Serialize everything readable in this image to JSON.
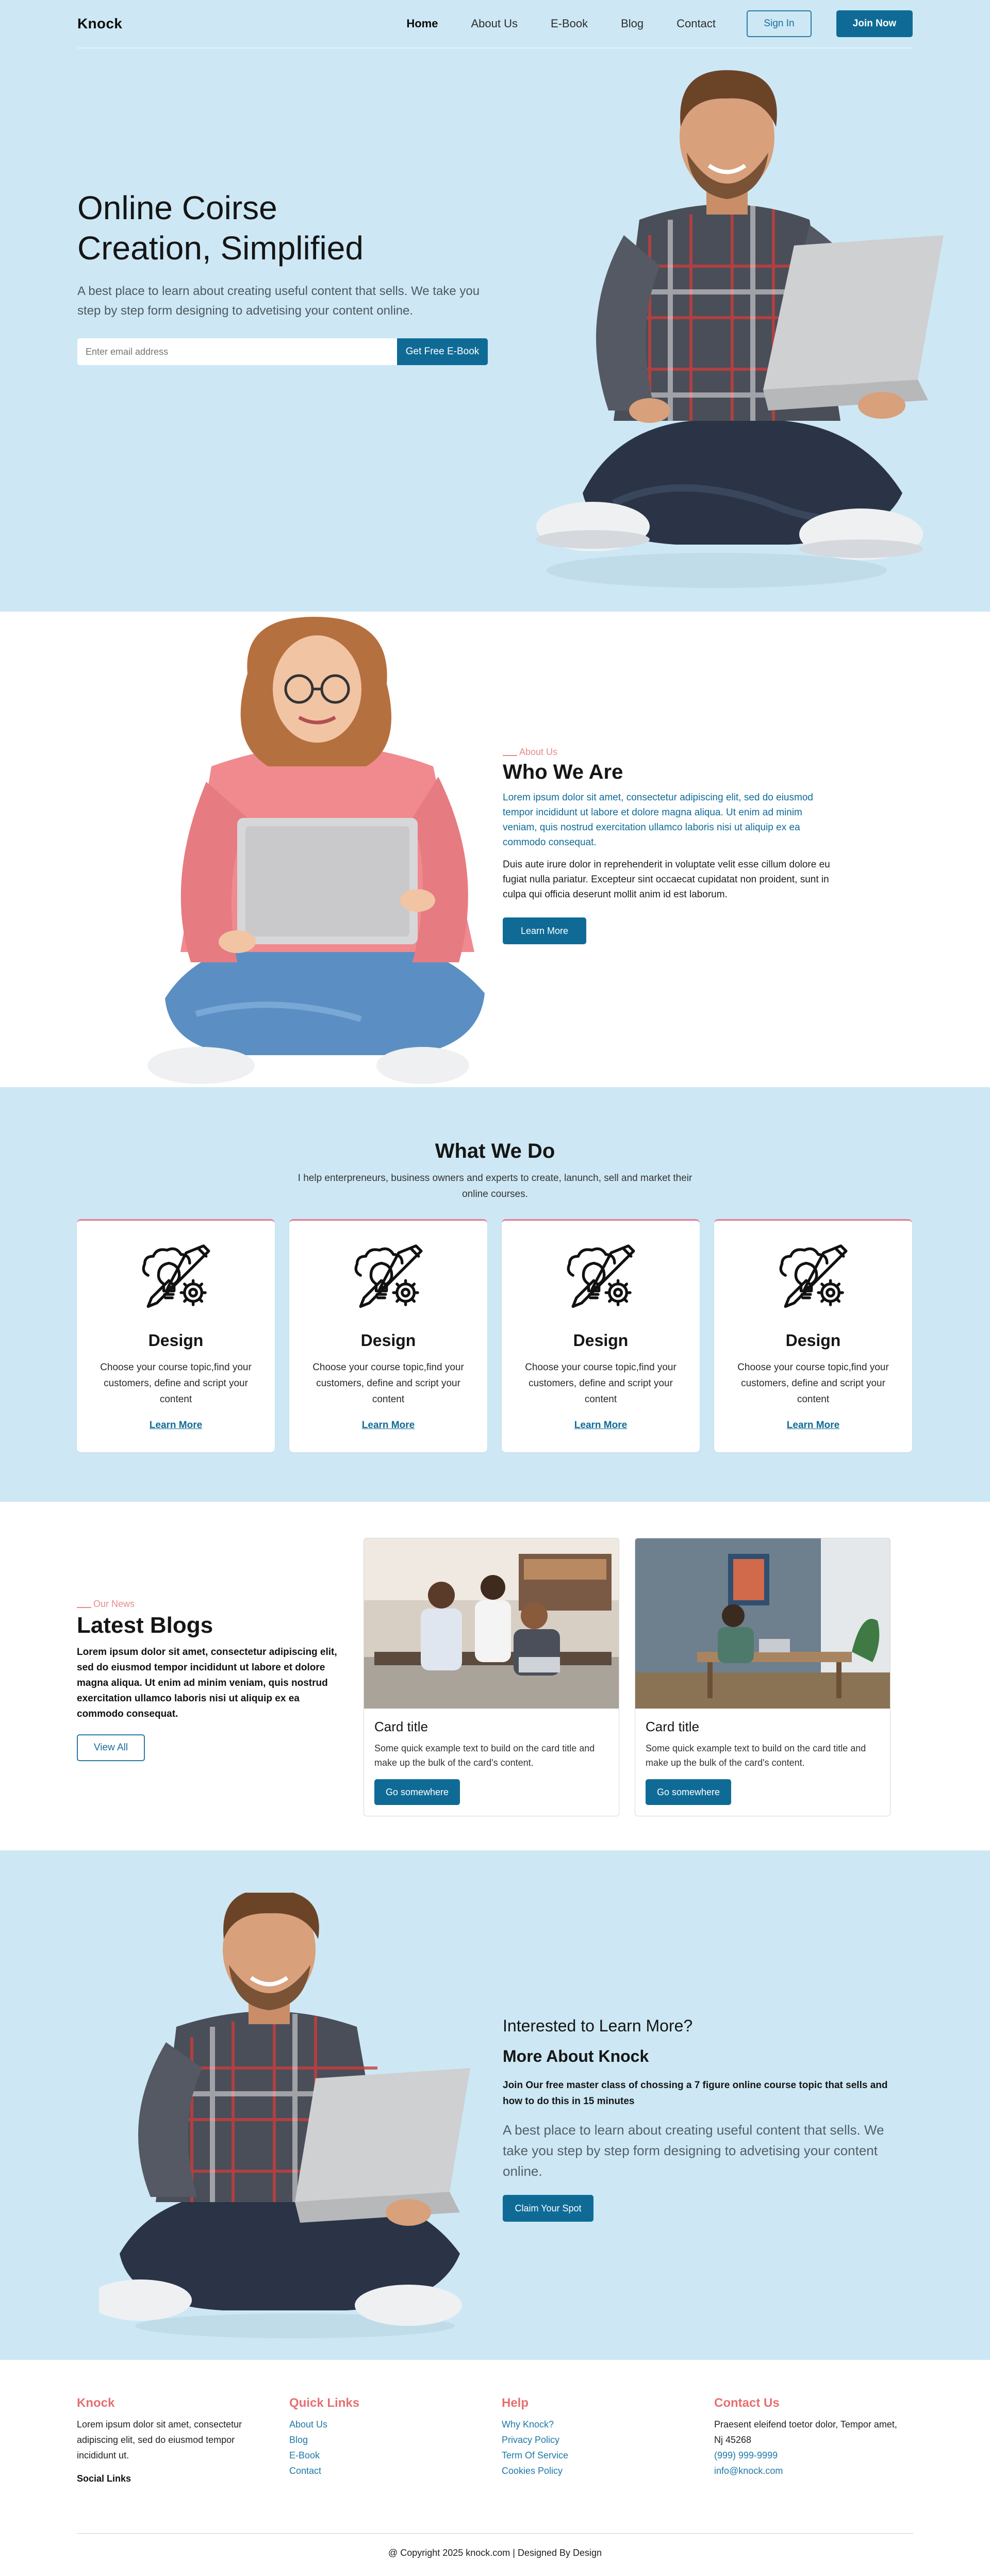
{
  "nav": {
    "brand": "Knock",
    "links": [
      "Home",
      "About Us",
      "E-Book",
      "Blog",
      "Contact"
    ],
    "sign_in": "Sign In",
    "join": "Join Now"
  },
  "hero": {
    "title_line1": "Online Coirse",
    "title_line2": "Creation, Simplified",
    "subtitle": "A best place to learn about creating useful content that sells. We take you step by step form designing to advetising your content online.",
    "email_placeholder": "Enter email address",
    "cta": "Get Free E-Book"
  },
  "about": {
    "eyebrow": "About Us",
    "title": "Who We Are",
    "lead": "Lorem ipsum dolor sit amet, consectetur adipiscing elit, sed do eiusmod tempor incididunt ut labore et dolore magna aliqua. Ut enim ad minim veniam, quis nostrud exercitation ullamco laboris nisi ut aliquip ex ea commodo consequat.",
    "body": "Duis aute irure dolor in reprehenderit in voluptate velit esse cillum dolore eu fugiat nulla pariatur. Excepteur sint occaecat cupidatat non proident, sunt in culpa qui officia deserunt mollit anim id est laborum.",
    "button": "Learn More"
  },
  "services": {
    "title": "What We Do",
    "subtitle": "I help enterpreneurs, business owners and experts to create, lanunch, sell and market their online courses.",
    "cards": [
      {
        "title": "Design",
        "text": "Choose your course topic,find your customers, define and script your content",
        "link": "Learn More"
      },
      {
        "title": "Design",
        "text": "Choose your course topic,find your customers, define and script your content",
        "link": "Learn More"
      },
      {
        "title": "Design",
        "text": "Choose your course topic,find your customers, define and script your content",
        "link": "Learn More"
      },
      {
        "title": "Design",
        "text": "Choose your course topic,find your customers, define and script your content",
        "link": "Learn More"
      }
    ]
  },
  "blogs": {
    "eyebrow": "Our News",
    "title": "Latest Blogs",
    "lead": "Lorem ipsum dolor sit amet, consectetur adipiscing elit, sed do eiusmod tempor incididunt ut labore et dolore magna aliqua. Ut enim ad minim veniam, quis nostrud exercitation ullamco laboris nisi ut aliquip ex ea commodo consequat.",
    "view_all": "View All",
    "cards": [
      {
        "title": "Card title",
        "text": "Some quick example text to build on the card title and make up the bulk of the card's content.",
        "button": "Go somewhere"
      },
      {
        "title": "Card title",
        "text": "Some quick example text to build on the card title and make up the bulk of the card's content.",
        "button": "Go somewhere"
      }
    ]
  },
  "cta": {
    "kicker": "Interested to Learn More?",
    "title": "More About Knock",
    "lead": "Join Our free master class of chossing a 7 figure online course topic that sells and how to do this in 15 minutes",
    "body": "A best place to learn about creating useful content that sells. We take you step by step form designing to advetising your content online.",
    "button": "Claim Your Spot"
  },
  "footer": {
    "brand": "Knock",
    "about": "Lorem ipsum dolor sit amet, consectetur adipiscing elit, sed do eiusmod tempor incididunt ut.",
    "social_label": "Social Links",
    "quick_links_title": "Quick Links",
    "quick_links": [
      "About Us",
      "Blog",
      "E-Book",
      "Contact"
    ],
    "help_title": "Help",
    "help_links": [
      "Why Knock?",
      "Privacy Policy",
      "Term Of Service",
      "Cookies Policy"
    ],
    "contact_title": "Contact Us",
    "address": "Praesent eleifend toetor dolor, Tempor amet, Nj 45268",
    "phone": "(999) 999-9999",
    "email": "info@knock.com",
    "copyright": "@ Copyright 2025 knock.com | Designed By Design"
  },
  "colors": {
    "primary": "#0f6b96",
    "section_bg": "#cde8f4",
    "accent": "#e57070"
  }
}
